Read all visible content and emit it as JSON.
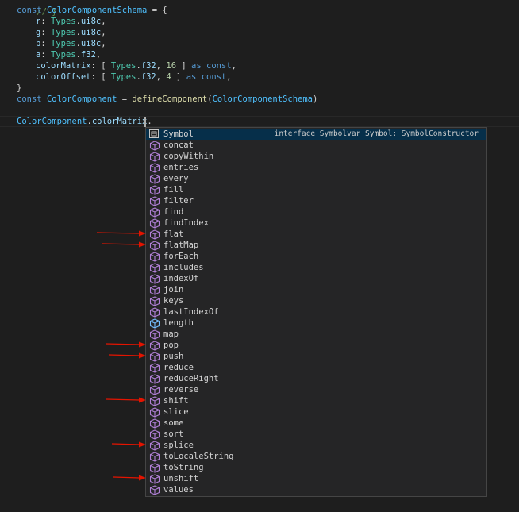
{
  "editor": {
    "top_fragment": "// }",
    "schema_line": {
      "kw": "const",
      "name": "ColorComponentSchema",
      "rest": " = {"
    },
    "fields": [
      {
        "name": "r",
        "type_ns": "Types",
        "type_name": "ui8c"
      },
      {
        "name": "g",
        "type_ns": "Types",
        "type_name": "ui8c"
      },
      {
        "name": "b",
        "type_ns": "Types",
        "type_name": "ui8c"
      },
      {
        "name": "a",
        "type_ns": "Types",
        "type_name": "f32"
      }
    ],
    "color_matrix": {
      "name": "colorMatrix",
      "open": ": [ ",
      "type_ns": "Types",
      "type_name": "f32",
      "sep": ", ",
      "num": "16",
      "close": " ] ",
      "as": "as",
      "const": "const",
      "end": ","
    },
    "color_offset": {
      "name": "colorOffset",
      "open": ": [ ",
      "type_ns": "Types",
      "type_name": "f32",
      "sep": ", ",
      "num": "4",
      "close": " ] ",
      "as": "as",
      "const": "const",
      "end": ","
    },
    "close_brace": "}",
    "component_line": {
      "kw": "const",
      "name": "ColorComponent",
      "eq": " = ",
      "fn": "defineComponent",
      "open": "(",
      "arg": "ColorComponentSchema",
      "close": ")"
    },
    "access_line": {
      "obj": "ColorComponent",
      "dot1": ".",
      "prop": "colorMatrix",
      "dot2": "."
    }
  },
  "suggestions": {
    "selected_detail": "interface Symbolvar Symbol: SymbolConstructor",
    "items": [
      {
        "label": "Symbol",
        "icon": "symbol-class-icon"
      },
      {
        "label": "concat",
        "icon": "method-cube-icon"
      },
      {
        "label": "copyWithin",
        "icon": "method-cube-icon"
      },
      {
        "label": "entries",
        "icon": "method-cube-icon"
      },
      {
        "label": "every",
        "icon": "method-cube-icon"
      },
      {
        "label": "fill",
        "icon": "method-cube-icon"
      },
      {
        "label": "filter",
        "icon": "method-cube-icon"
      },
      {
        "label": "find",
        "icon": "method-cube-icon"
      },
      {
        "label": "findIndex",
        "icon": "method-cube-icon"
      },
      {
        "label": "flat",
        "icon": "method-cube-icon"
      },
      {
        "label": "flatMap",
        "icon": "method-cube-icon"
      },
      {
        "label": "forEach",
        "icon": "method-cube-icon"
      },
      {
        "label": "includes",
        "icon": "method-cube-icon"
      },
      {
        "label": "indexOf",
        "icon": "method-cube-icon"
      },
      {
        "label": "join",
        "icon": "method-cube-icon"
      },
      {
        "label": "keys",
        "icon": "method-cube-icon"
      },
      {
        "label": "lastIndexOf",
        "icon": "method-cube-icon"
      },
      {
        "label": "length",
        "icon": "field-cube-icon"
      },
      {
        "label": "map",
        "icon": "method-cube-icon"
      },
      {
        "label": "pop",
        "icon": "method-cube-icon"
      },
      {
        "label": "push",
        "icon": "method-cube-icon"
      },
      {
        "label": "reduce",
        "icon": "method-cube-icon"
      },
      {
        "label": "reduceRight",
        "icon": "method-cube-icon"
      },
      {
        "label": "reverse",
        "icon": "method-cube-icon"
      },
      {
        "label": "shift",
        "icon": "method-cube-icon"
      },
      {
        "label": "slice",
        "icon": "method-cube-icon"
      },
      {
        "label": "some",
        "icon": "method-cube-icon"
      },
      {
        "label": "sort",
        "icon": "method-cube-icon"
      },
      {
        "label": "splice",
        "icon": "method-cube-icon"
      },
      {
        "label": "toLocaleString",
        "icon": "method-cube-icon"
      },
      {
        "label": "toString",
        "icon": "method-cube-icon"
      },
      {
        "label": "unshift",
        "icon": "method-cube-icon"
      },
      {
        "label": "values",
        "icon": "method-cube-icon"
      }
    ],
    "annotated_items": [
      "flat",
      "flatMap",
      "pop",
      "push",
      "shift",
      "splice",
      "unshift"
    ]
  },
  "colors": {
    "method_icon": "#b180d7",
    "field_icon": "#75beff",
    "annotation_arrow": "#e51400",
    "selection": "#062f4a"
  }
}
